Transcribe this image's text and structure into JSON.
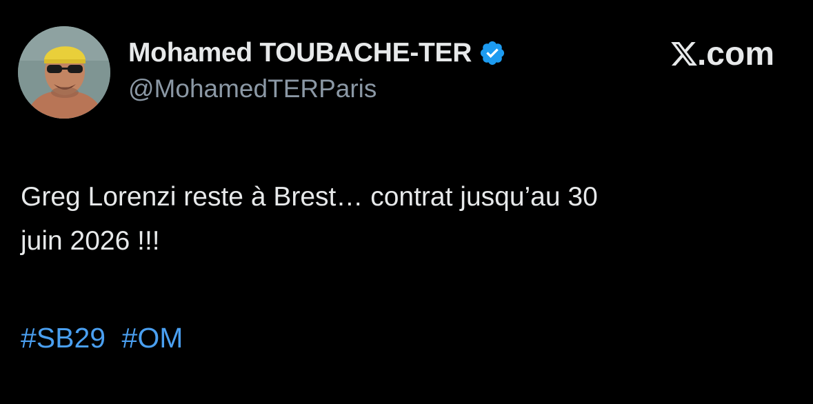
{
  "author": {
    "display_name": "Mohamed TOUBACHE-TER",
    "handle": "@MohamedTERParis",
    "verified": true,
    "verified_icon": "verified-badge-icon"
  },
  "brand": {
    "logo_icon": "x-logo-icon",
    "text": ".com"
  },
  "tweet": {
    "lines": [
      "Greg Lorenzi reste à Brest… contrat jusqu’au 30",
      "juin 2026 !!!"
    ],
    "hashtags": [
      "#SB29",
      "#OM"
    ]
  },
  "colors": {
    "background": "#000000",
    "text": "#e7e9ea",
    "secondary_text": "#8b98a5",
    "link": "#4a9ff0",
    "verified": "#1d9bf0"
  }
}
